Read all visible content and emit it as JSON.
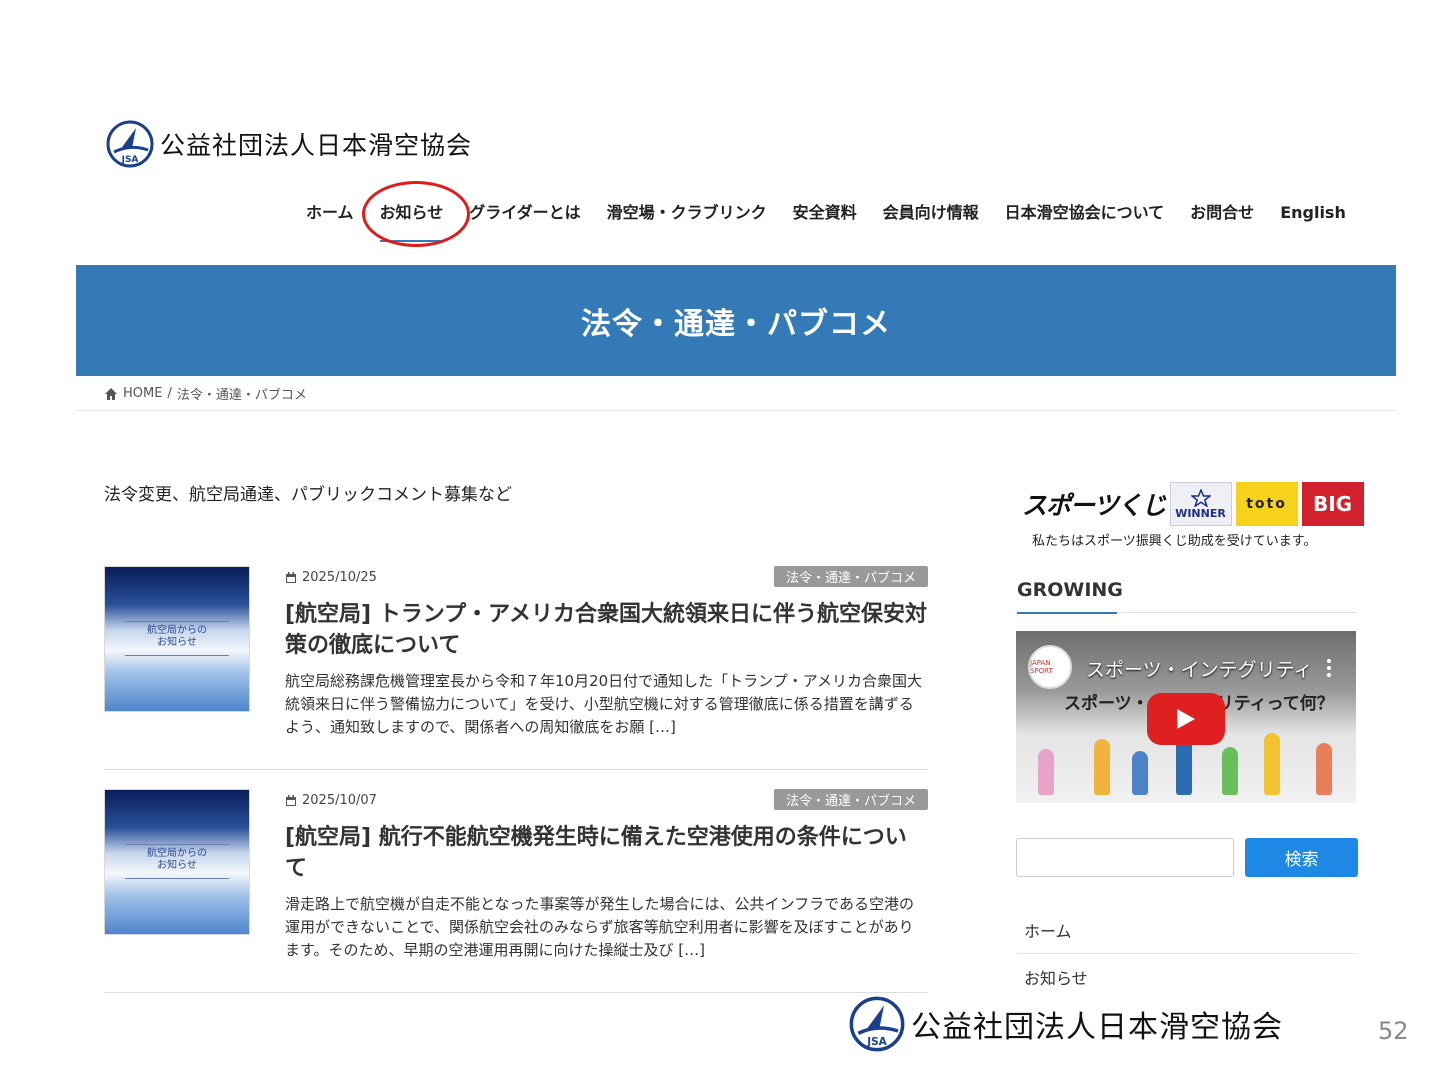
{
  "site": {
    "name": "公益社団法人日本滑空協会",
    "logo_mark": "JSA"
  },
  "nav": {
    "items": [
      "ホーム",
      "お知らせ",
      "グライダーとは",
      "滑空場・クラブリンク",
      "安全資料",
      "会員向け情報",
      "日本滑空協会について",
      "お問合せ",
      "English"
    ],
    "active_index": 1
  },
  "banner": {
    "title": "法令・通達・パブコメ"
  },
  "breadcrumb": {
    "home": "HOME",
    "separator": "/",
    "current": "法令・通達・パブコメ"
  },
  "lead": "法令変更、航空局通達、パブリックコメント募集など",
  "posts": [
    {
      "date": "2025/10/25",
      "tag": "法令・通達・パブコメ",
      "title": "[航空局] トランプ・アメリカ合衆国大統領来日に伴う航空保安対策の徹底について",
      "excerpt": "航空局総務課危機管理室長から令和７年10月20日付で通知した「トランプ・アメリカ合衆国大統領来日に伴う警備協力について」を受け、小型航空機に対する管理徹底に係る措置を講ずるよう、通知致しますので、関係者への周知徹底をお願 […]",
      "thumb_text": [
        "航空局からの",
        "お知らせ"
      ]
    },
    {
      "date": "2025/10/07",
      "tag": "法令・通達・パブコメ",
      "title": "[航空局] 航行不能航空機発生時に備えた空港使用の条件について",
      "excerpt": "滑走路上で航空機が自走不能となった事案等が発生した場合には、公共インフラである空港の運用ができないことで、関係航空会社のみならず旅客等航空利用者に影響を及ぼすことがあります。そのため、早期の空港運用再開に向けた操縦士及び […]",
      "thumb_text": [
        "航空局からの",
        "お知らせ"
      ]
    }
  ],
  "sidebar": {
    "kuji": {
      "logo": "スポーツくじ",
      "winner": "WINNER",
      "toto": "toto",
      "big": "BIG",
      "note": "私たちはスポーツ振興くじ助成を受けています。"
    },
    "widget_title": "GROWING",
    "video": {
      "channel": "JAPAN SPORT",
      "title": "スポーツ・インテグリティ",
      "subtitle": "スポーツ・インテグリティって何？"
    },
    "search": {
      "placeholder": "",
      "button": "検索"
    },
    "links": [
      "ホーム",
      "お知らせ"
    ]
  },
  "footer": {
    "name": "公益社団法人日本滑空協会",
    "page_number": "52"
  },
  "colors": {
    "brand_blue": "#337ab7",
    "search_blue": "#1e88e5",
    "highlight_red": "#e01b1b",
    "tag_gray": "#999999",
    "play_red": "#e02020"
  }
}
